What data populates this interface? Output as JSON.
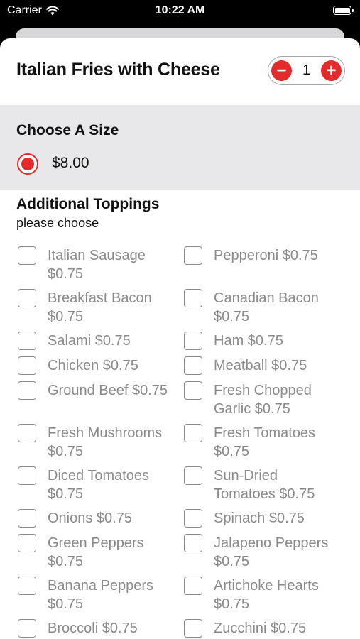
{
  "status": {
    "carrier": "Carrier",
    "time": "10:22 AM"
  },
  "item": {
    "title": "Italian Fries with Cheese",
    "quantity": "1",
    "minus": "−",
    "plus": "+"
  },
  "size": {
    "title": "Choose A Size",
    "options": [
      {
        "label": "$8.00",
        "selected": true
      }
    ]
  },
  "toppings": {
    "title": "Additional Toppings",
    "subtitle": "please choose",
    "left": [
      "Italian Sausage\n$0.75",
      "Breakfast Bacon\n$0.75",
      "Salami $0.75",
      "Chicken $0.75",
      "Ground Beef $0.75",
      "Fresh Mushrooms\n$0.75",
      "Diced Tomatoes\n$0.75",
      "Onions $0.75",
      "Green Peppers\n$0.75",
      "Banana Peppers\n$0.75",
      "Broccoli $0.75"
    ],
    "right": [
      "Pepperoni $0.75",
      "Canadian Bacon\n$0.75",
      "Ham $0.75",
      "Meatball $0.75",
      "Fresh Chopped\nGarlic $0.75",
      "Fresh Tomatoes\n$0.75",
      "Sun-Dried\nTomatoes $0.75",
      "Spinach $0.75",
      "Jalapeno Peppers\n$0.75",
      "Artichoke Hearts\n$0.75",
      "Zucchini $0.75"
    ]
  },
  "colors": {
    "accent": "#e32b2b",
    "muted": "#8b8b8b",
    "section_bg": "#e8e8ea"
  },
  "icons": {
    "signal": "wifi-icon",
    "battery": "battery-icon",
    "minus": "minus-circle-icon",
    "plus": "plus-circle-icon"
  }
}
